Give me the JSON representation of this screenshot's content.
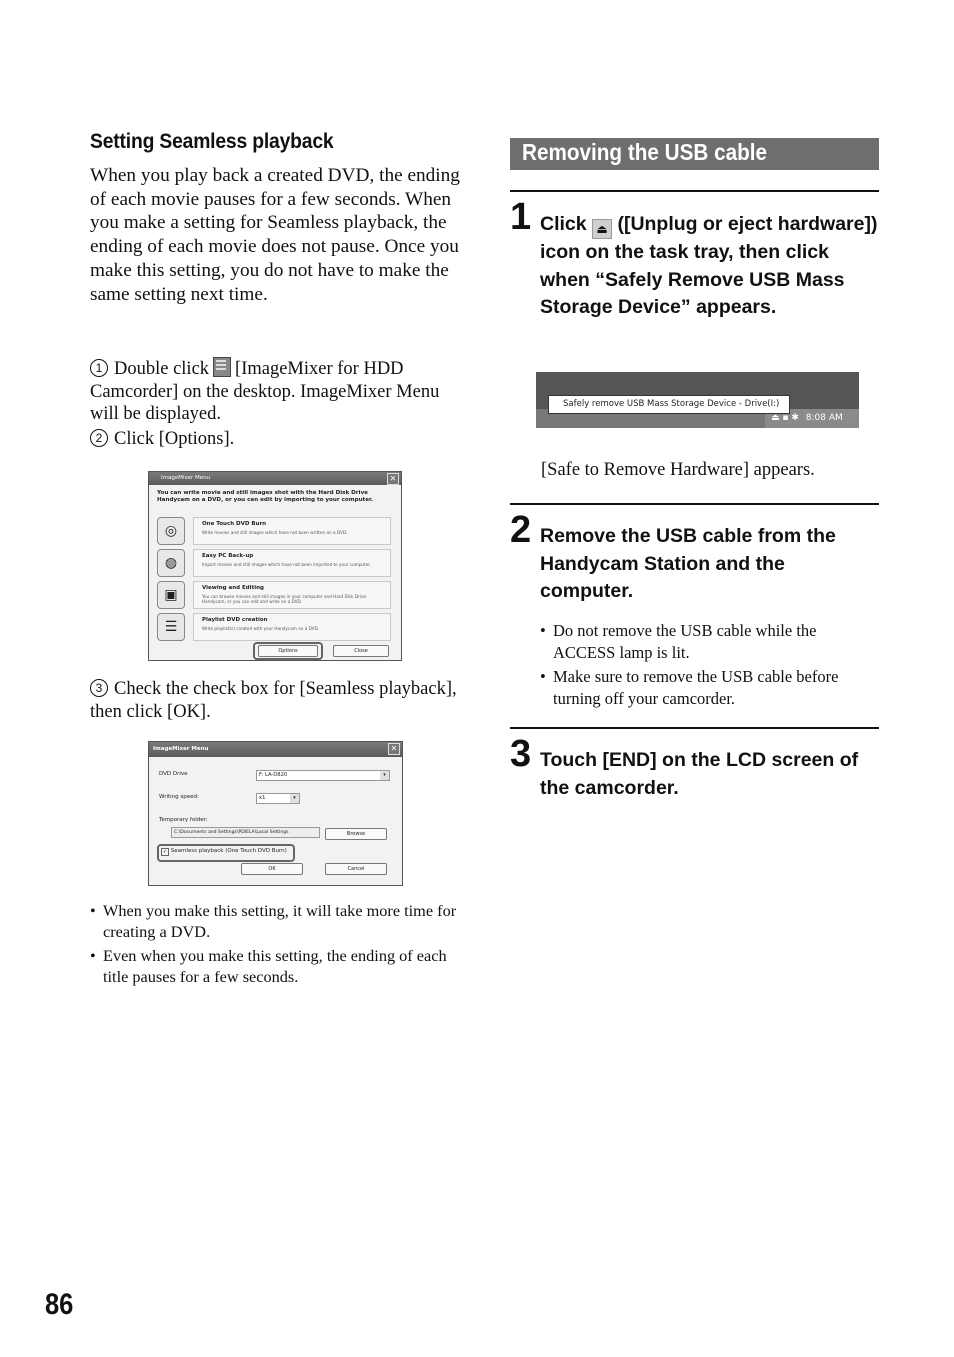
{
  "left": {
    "section_title": "Setting Seamless playback",
    "intro": "When you play back a created DVD, the ending of each movie pauses for a few seconds. When you make a setting for Seamless playback, the ending of each movie does not pause. Once you make this setting, you do not have to make the same setting next time.",
    "steps": [
      {
        "num": "1",
        "text_before_icon": "Double click",
        "icon": "imagemixer-desktop-icon",
        "text_after_icon": "[ImageMixer for HDD Camcorder] on the desktop. ImageMixer Menu will be displayed."
      },
      {
        "num": "2",
        "text": "Click [Options]."
      },
      {
        "num": "3",
        "text": "Check the check box for [Seamless playback], then click [OK]."
      }
    ],
    "menu_dialog": {
      "title": "ImageMixer Menu",
      "description": "You can write movie and still images shot with the Hard Disk Drive Handycam on a DVD, or you can edit by importing to your computer.",
      "items": [
        {
          "title": "One Touch DVD Burn",
          "desc": "Write movies and still images which have not been written on a DVD.",
          "icon": "disc-touch-icon"
        },
        {
          "title": "Easy PC Back-up",
          "desc": "Import movies and still images which have not been imported to your computer.",
          "icon": "disc-backup-icon"
        },
        {
          "title": "Viewing and Editing",
          "desc": "You can browse movies and still images in your computer and Hard Disk Drive Handycam, or you can edit and write on a DVD.",
          "icon": "photos-icon"
        },
        {
          "title": "Playlist DVD creation",
          "desc": "Write playlist(s) created with your Handycam on a DVD.",
          "icon": "list-icon"
        }
      ],
      "options_label": "Options",
      "close_label": "Close"
    },
    "options_dialog": {
      "title": "ImageMixer Menu",
      "dvd_drive_label": "DVD Drive",
      "dvd_drive_value": "F: LA-D820",
      "writing_speed_label": "Writing speed:",
      "writing_speed_value": "x1",
      "temp_folder_label": "Temporary folder:",
      "temp_folder_value": "C:\\Documents and Settings\\PDIELA\\Local Settings",
      "browse_label": "Browse",
      "seamless_label": "Seamless playback (One Touch DVD Burn)",
      "seamless_checked": true,
      "ok_label": "OK",
      "cancel_label": "Cancel"
    },
    "notes": [
      "When you make this setting, it will take more time for creating a DVD.",
      "Even when you make this setting, the ending of each title pauses for a few seconds."
    ]
  },
  "right": {
    "banner": "Removing the USB cable",
    "step1": {
      "num": "1",
      "text_before_icon": "Click",
      "icon": "unplug-eject-icon",
      "text_after_icon": "([Unplug or eject hardware]) icon on the task tray, then click when “Safely Remove USB Mass Storage Device” appears."
    },
    "taskbar": {
      "tooltip": "Safely remove USB Mass Storage Device - Drive(I:)",
      "clock": "8:08 AM"
    },
    "caption": "[Safe to Remove Hardware] appears.",
    "step2": {
      "num": "2",
      "text": "Remove the USB cable from the Handycam Station and the computer."
    },
    "step2_notes": [
      "Do not remove the USB cable while the ACCESS lamp is lit.",
      "Make sure to remove the USB cable before turning off your camcorder."
    ],
    "step3": {
      "num": "3",
      "text": "Touch [END] on the LCD screen of the camcorder."
    }
  },
  "page_number": "86"
}
